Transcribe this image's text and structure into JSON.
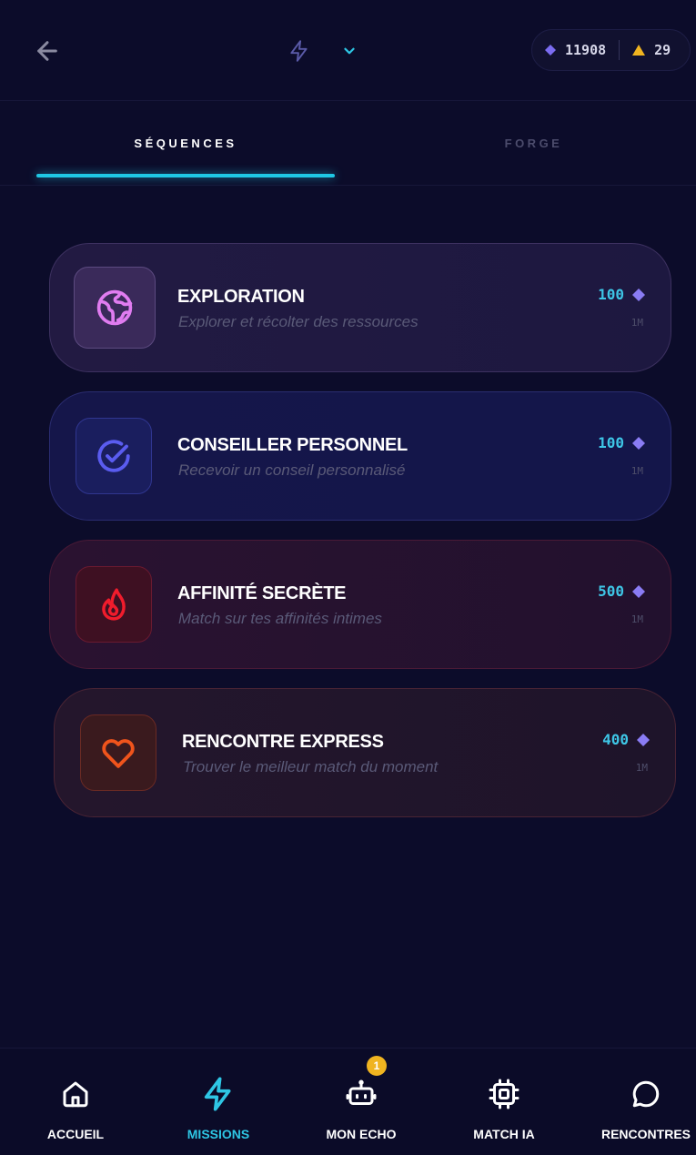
{
  "header": {
    "back_icon": "arrow-left-icon",
    "mode_icon": "bolt-icon",
    "mode_chevron": "chevron-down-icon",
    "wallet": {
      "gems": "11908",
      "gem_color": "#7b6cf0",
      "tokens": "29",
      "token_color": "#f0b420"
    }
  },
  "tabs": [
    {
      "label": "SÉQUENCES",
      "active": true
    },
    {
      "label": "FORGE",
      "active": false
    }
  ],
  "missions": [
    {
      "title": "EXPLORATION",
      "subtitle": "Explorer et récolter des ressources",
      "price": "100",
      "duration": "1M",
      "icon": "globe-icon",
      "accent": "#e07cf0"
    },
    {
      "title": "CONSEILLER PERSONNEL",
      "subtitle": "Recevoir un conseil personnalisé",
      "price": "100",
      "duration": "1M",
      "icon": "check-circle-icon",
      "accent": "#5a5cf0"
    },
    {
      "title": "AFFINITÉ SECRÈTE",
      "subtitle": "Match sur tes affinités intimes",
      "price": "500",
      "duration": "1M",
      "icon": "flame-icon",
      "accent": "#f01c2c"
    },
    {
      "title": "RENCONTRE EXPRESS",
      "subtitle": "Trouver le meilleur match du moment",
      "price": "400",
      "duration": "1M",
      "icon": "heart-icon",
      "accent": "#f0541c"
    }
  ],
  "nav": [
    {
      "label": "ACCUEIL",
      "icon": "home-icon",
      "active": false
    },
    {
      "label": "MISSIONS",
      "icon": "bolt-icon",
      "active": true
    },
    {
      "label": "MON ECHO",
      "icon": "robot-icon",
      "active": false,
      "badge": "1"
    },
    {
      "label": "MATCH IA",
      "icon": "chip-icon",
      "active": false
    },
    {
      "label": "RENCONTRES",
      "icon": "chat-bubble-icon",
      "active": false
    }
  ],
  "colors": {
    "background": "#0c0c2a",
    "accent_cyan": "#1fc7e4",
    "gem_purple": "#8a7cf4"
  }
}
